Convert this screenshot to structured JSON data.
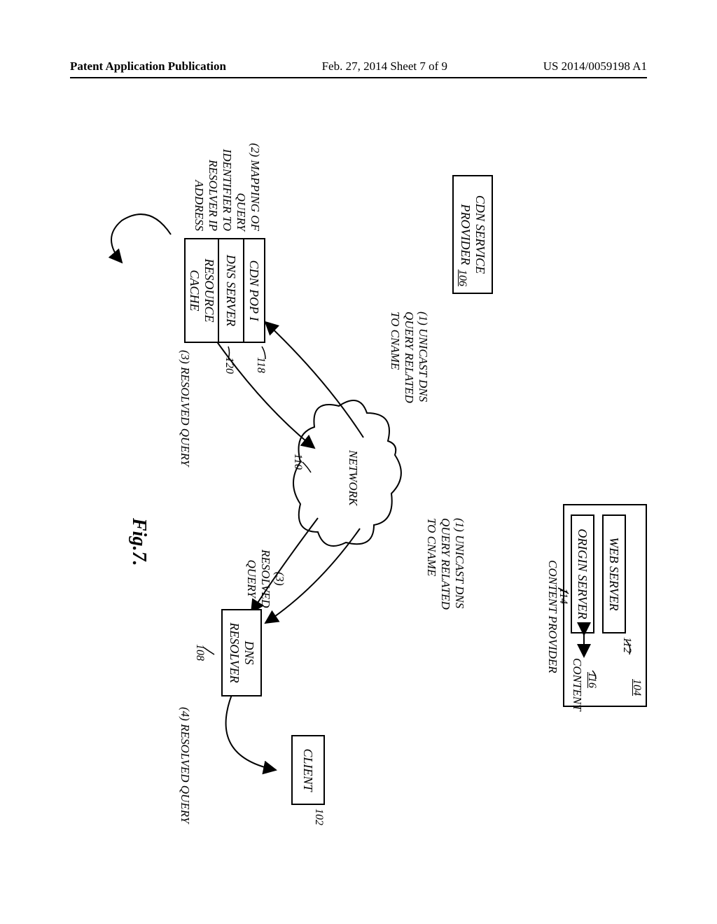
{
  "header": {
    "left": "Patent Application Publication",
    "center": "Feb. 27, 2014  Sheet 7 of 9",
    "right": "US 2014/0059198 A1"
  },
  "content_provider": {
    "group_ref": "104",
    "label": "CONTENT PROVIDER",
    "web_server": {
      "label": "WEB SERVER",
      "ref": "112"
    },
    "origin_server": {
      "label": "ORIGIN SERVER",
      "ref": "114"
    },
    "content_store": {
      "label": "CONTENT",
      "ref": "116"
    }
  },
  "cdn_service_provider": {
    "label_line1": "CDN SERVICE",
    "label_line2": "PROVIDER",
    "ref": "106"
  },
  "cdn_pop": {
    "pop_label": "CDN POP I",
    "pop_ref": "118",
    "dns_label": "DNS SERVER",
    "dns_ref": "120",
    "cache_label_line1": "RESOURCE",
    "cache_label_line2": "CACHE"
  },
  "network": {
    "label": "NETWORK",
    "ref": "110"
  },
  "client": {
    "label": "CLIENT",
    "ref": "102"
  },
  "dns_resolver": {
    "label_line1": "DNS",
    "label_line2": "RESOLVER",
    "ref": "108"
  },
  "flows": {
    "step1_line1": "(1) UNICAST DNS",
    "step1_line2": "QUERY RELATED",
    "step1_line3": "TO CNAME",
    "step2_line1": "(2) MAPPING OF",
    "step2_line2": "QUERY",
    "step2_line3": "IDENTIFIER TO",
    "step2_line4": "RESOLVER IP",
    "step2_line5": "ADDRESS",
    "step3_line1": "(3)",
    "step3_line2": "RESOLVED",
    "step3_line3": "QUERY",
    "step3_alt": "(3) RESOLVED QUERY",
    "step4": "(4) RESOLVED QUERY"
  },
  "figure_caption": "Fig.7."
}
